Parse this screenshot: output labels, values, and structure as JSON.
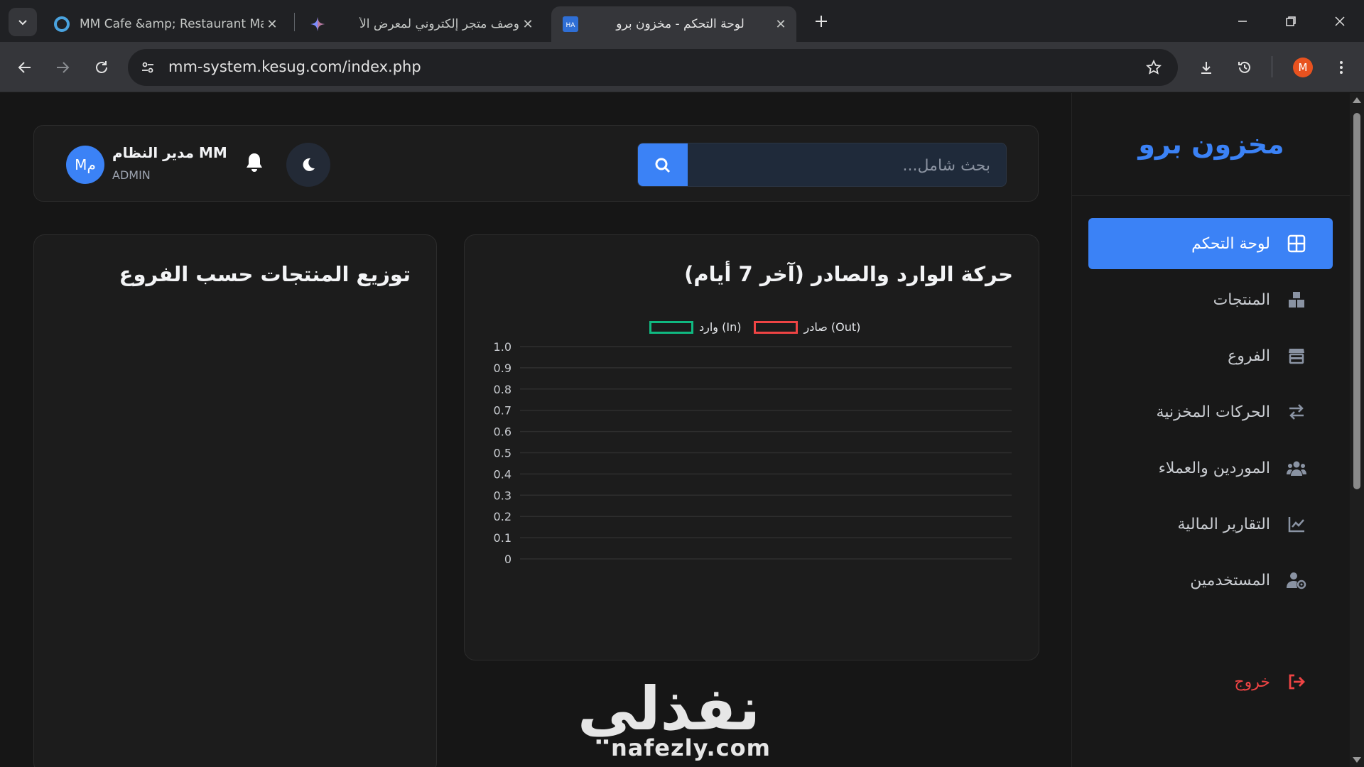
{
  "browser": {
    "tabs": [
      {
        "title": "MM Cafe &amp; Restaurant Ma",
        "favicon": "cafe-favicon"
      },
      {
        "title": "وصف متجر إلكتروني لمعرض الأ",
        "favicon": "gemini-sparkle"
      },
      {
        "title": "لوحة التحكم - مخزون برو",
        "favicon": "HA",
        "active": true
      }
    ],
    "url": "mm-system.kesug.com/index.php",
    "profile_initial": "M",
    "colors": {
      "tabbar": "#202124",
      "toolbar": "#35363a",
      "profile": "#e8521f"
    }
  },
  "sidebar": {
    "brand": "مخزون برو",
    "items": [
      {
        "label": "لوحة التحكم",
        "icon": "grid-icon",
        "active": true
      },
      {
        "label": "المنتجات",
        "icon": "boxes-icon"
      },
      {
        "label": "الفروع",
        "icon": "store-icon"
      },
      {
        "label": "الحركات المخزنية",
        "icon": "exchange-icon"
      },
      {
        "label": "الموردين والعملاء",
        "icon": "users-icon"
      },
      {
        "label": "التقارير المالية",
        "icon": "chart-line-icon"
      },
      {
        "label": "المستخدمين",
        "icon": "user-cog-icon"
      }
    ],
    "logout": {
      "label": "خروج",
      "icon": "sign-out-icon"
    },
    "colors": {
      "accent": "#3b82f6",
      "logout": "#ef4444"
    }
  },
  "header": {
    "search_placeholder": "بحث شامل...",
    "user": {
      "name": "مدير النظام MM",
      "role": "ADMIN",
      "avatar_text": "Mم"
    }
  },
  "cards": {
    "movement": {
      "title": "حركة الوارد والصادر (آخر 7 أيام)"
    },
    "distribution": {
      "title": "توزيع المنتجات حسب الفروع"
    }
  },
  "chart_data": {
    "type": "bar",
    "title": "حركة الوارد والصادر (آخر 7 أيام)",
    "series": [
      {
        "name": "صادر (Out)",
        "values": [],
        "color": "#ef4444"
      },
      {
        "name": "وارد (In)",
        "values": [],
        "color": "#10b981"
      }
    ],
    "ylim": [
      0,
      1
    ],
    "y_ticks": [
      "1.0",
      "0.9",
      "0.8",
      "0.7",
      "0.6",
      "0.5",
      "0.4",
      "0.3",
      "0.2",
      "0.1",
      "0"
    ],
    "grid": true,
    "legend": "top-center"
  },
  "watermark": {
    "arabic": "نفذلي",
    "latin": "nafezly.com"
  }
}
